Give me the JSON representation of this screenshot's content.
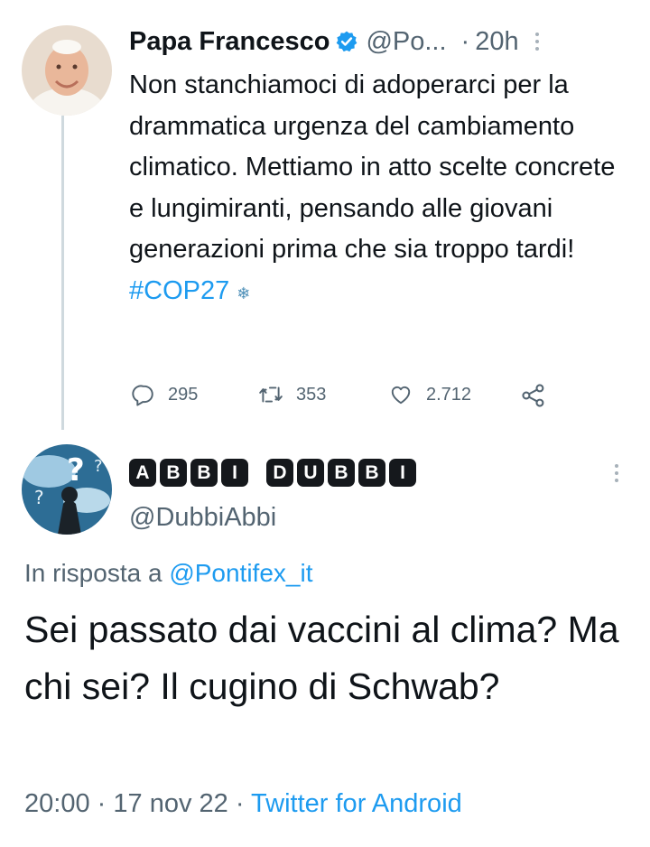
{
  "original_tweet": {
    "display_name": "Papa Francesco",
    "handle": "@Po...",
    "time_separator": "·",
    "time": "20h",
    "text": "Non stanchiamoci di adoperarci per la drammatica urgenza del cambiamento climatico. Mettiamo in atto scelte concrete e lungimiranti, pensando alle giovani generazioni prima che sia troppo tardi!",
    "hashtag": "#COP27",
    "hashtag_emoji": "❄",
    "reply_count": "295",
    "retweet_count": "353",
    "like_count": "2.712"
  },
  "reply_tweet": {
    "display_name_tiles": [
      "A",
      "B",
      "B",
      "I",
      " ",
      "D",
      "U",
      "B",
      "B",
      "I"
    ],
    "handle": "@DubbiAbbi",
    "in_reply_to_prefix": "In risposta a",
    "in_reply_to_handle": "@Pontifex_it",
    "text": "Sei passato dai vaccini al clima? Ma chi sei? Il cugino di Schwab?",
    "time": "20:00",
    "date_separator": "·",
    "date": "17 nov 22",
    "source_separator": "·",
    "source": "Twitter for Android"
  },
  "colors": {
    "link_blue": "#1d9bf0",
    "secondary_gray": "#536471",
    "text_black": "#0f1419",
    "verified_blue": "#1d9bf0"
  },
  "icons": [
    "verified-badge-icon",
    "more-options-icon",
    "reply-icon",
    "retweet-icon",
    "like-icon",
    "share-icon"
  ]
}
